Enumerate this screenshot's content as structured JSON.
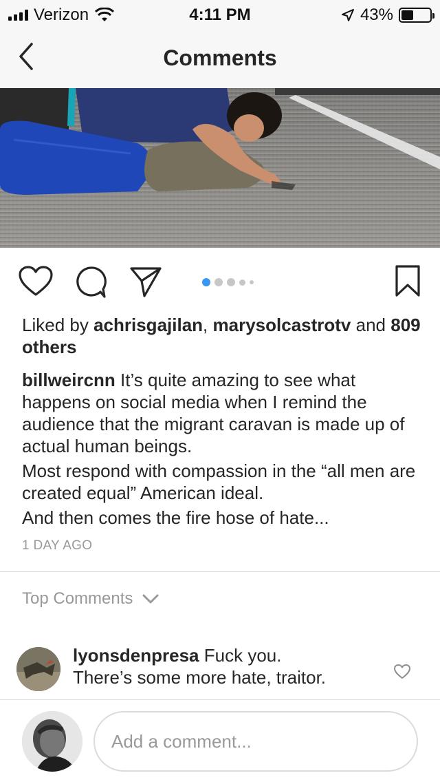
{
  "status_bar": {
    "carrier": "Verizon",
    "time": "4:11 PM",
    "battery": "43%",
    "battery_level": 0.43,
    "icons": [
      "signal-icon",
      "wifi-icon",
      "location-arrow-icon",
      "battery-icon"
    ]
  },
  "nav": {
    "title": "Comments",
    "back_icon": "chevron-left-icon"
  },
  "post": {
    "action_icons": [
      "heart-icon",
      "comment-icon",
      "share-icon",
      "bookmark-icon"
    ],
    "carousel": {
      "count": 5,
      "active": 0
    },
    "likes": {
      "prefix": "Liked by",
      "user1": "achrisgajilan",
      "separator": ",",
      "user2": "marysolcastrotv",
      "and": "and",
      "others": "809 others"
    },
    "caption": {
      "author": "billweircnn",
      "paragraph1": "It’s quite amazing to see what happens on social media when I remind the audience that the migrant caravan is made up of actual human beings.",
      "paragraph2": "Most respond with compassion in the “all men are created equal” American ideal.",
      "paragraph3": "And then comes the fire hose of hate..."
    },
    "timestamp": "1 DAY AGO"
  },
  "top_comments": {
    "label": "Top Comments",
    "icon": "chevron-down-icon"
  },
  "comments": [
    {
      "author": "lyonsdenpresa",
      "text": "Fuck you.",
      "text2": "There’s some more hate, traitor."
    }
  ],
  "compose": {
    "placeholder": "Add a comment..."
  },
  "colors": {
    "accent": "#3897f0",
    "text": "#262626",
    "muted": "#999999",
    "divider": "#dbdbdb",
    "bar_bg": "#f7f7f7"
  }
}
